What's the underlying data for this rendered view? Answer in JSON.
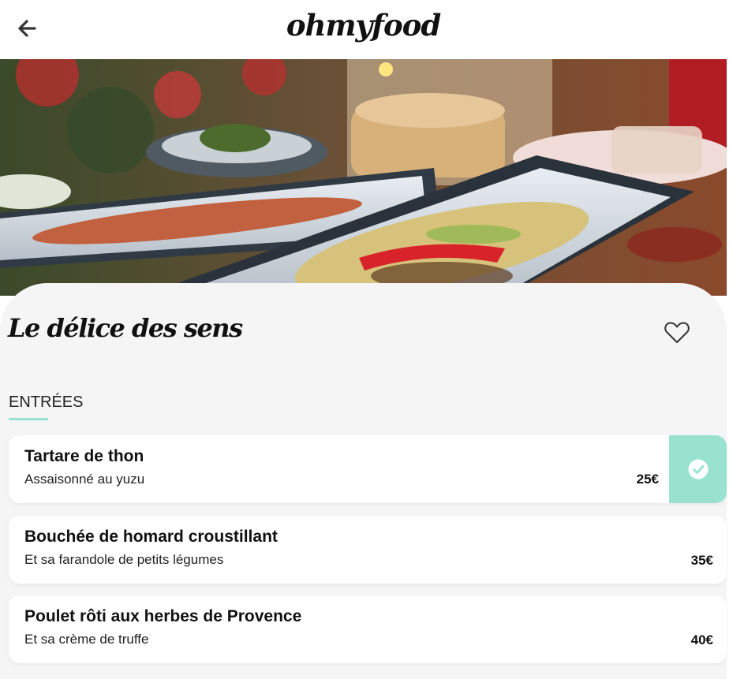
{
  "header": {
    "logo": "ohmyfood",
    "back_icon": "arrow-left-icon"
  },
  "restaurant": {
    "name": "Le délice des sens",
    "favorite_icon": "heart-outline-icon"
  },
  "menu": {
    "section_title": "ENTRÉES",
    "items": [
      {
        "name": "Tartare de thon",
        "description": "Assaisonné au yuzu",
        "price": "25€",
        "selected": true
      },
      {
        "name": "Bouchée de homard croustillant",
        "description": "Et sa farandole de petits légumes",
        "price": "35€",
        "selected": false
      },
      {
        "name": "Poulet rôti aux herbes de Provence",
        "description": "Et sa crème de truffe",
        "price": "40€",
        "selected": false
      }
    ]
  },
  "colors": {
    "accent": "#99e2d0",
    "background": "#f5f5f5"
  }
}
